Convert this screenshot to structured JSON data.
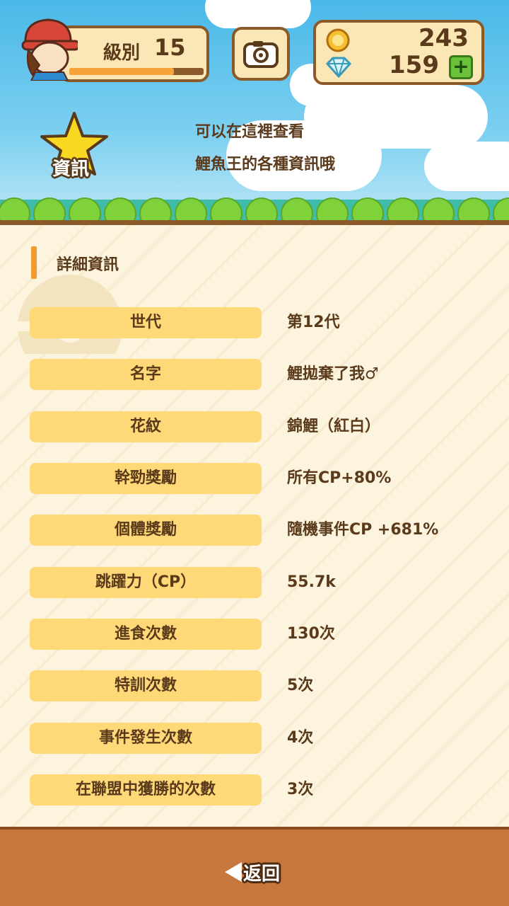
{
  "header": {
    "level_label": "級別",
    "level_value": "15",
    "level_progress": 0.78,
    "coins": "243",
    "diamonds": "159",
    "plus_label": "+",
    "badge_label": "資訊",
    "hint_lines": [
      "可以在這裡查看",
      "鯉魚王的各種資訊哦"
    ]
  },
  "section": {
    "title": "詳細資訊"
  },
  "rows": [
    {
      "label": "世代",
      "value": "第12代"
    },
    {
      "label": "名字",
      "value": "鯉拋棄了我♂"
    },
    {
      "label": "花紋",
      "value": "錦鯉（紅白）"
    },
    {
      "label": "幹勁獎勵",
      "value": "所有CP+80%"
    },
    {
      "label": "個體獎勵",
      "value": "隨機事件CP +681%"
    },
    {
      "label": "跳躍力（CP）",
      "value": "55.7k"
    },
    {
      "label": "進食次數",
      "value": "130次"
    },
    {
      "label": "特訓次數",
      "value": "5次"
    },
    {
      "label": "事件發生次數",
      "value": "4次"
    },
    {
      "label": "在聯盟中獲勝的次數",
      "value": "3次"
    }
  ],
  "footer": {
    "back_label": "返回"
  },
  "icons": {
    "camera": "camera-icon",
    "coin": "coin-icon",
    "diamond": "diamond-icon",
    "star": "star-icon",
    "back": "back-arrow-icon"
  },
  "colors": {
    "accent": "#f39a2e",
    "label_bg": "#ffd878",
    "border": "#8b5a2b",
    "footer": "#c7763e"
  }
}
